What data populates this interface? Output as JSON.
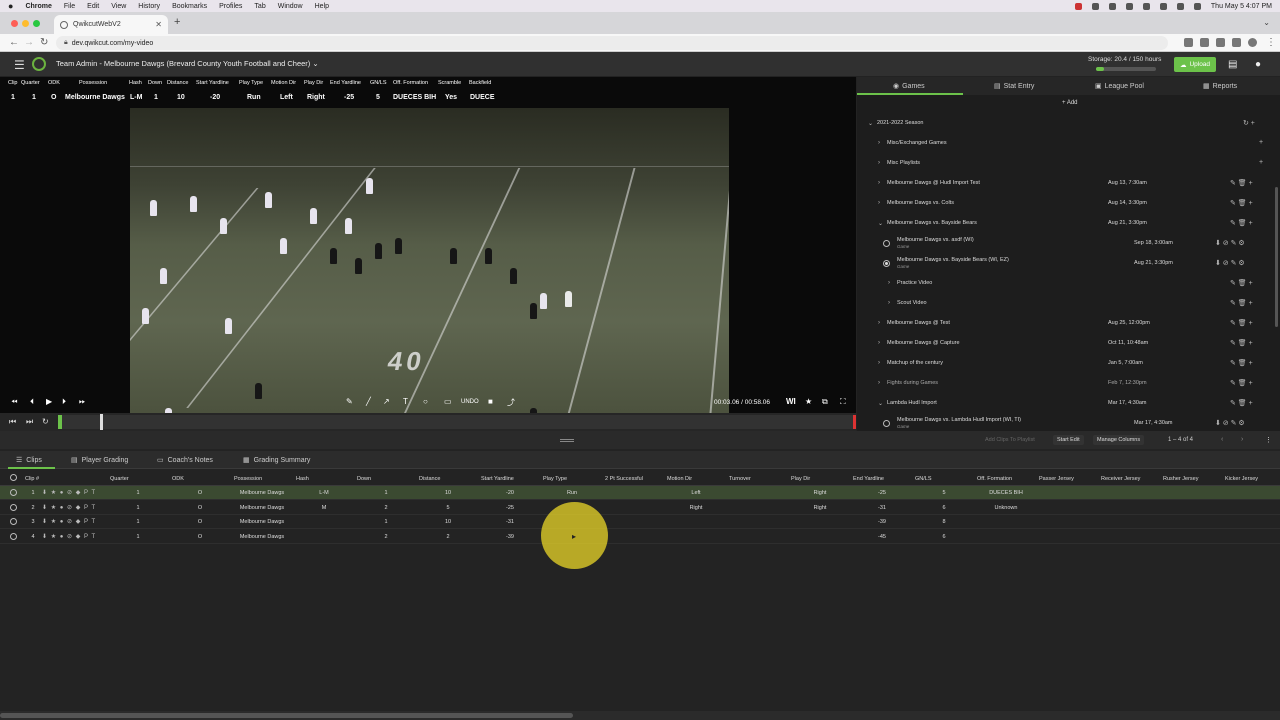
{
  "mac": {
    "menu": [
      "Chrome",
      "File",
      "Edit",
      "View",
      "History",
      "Bookmarks",
      "Profiles",
      "Tab",
      "Window",
      "Help"
    ],
    "clock": "Thu May 5  4:07 PM"
  },
  "browser": {
    "tab_title": "QwikcutWebV2",
    "url": "dev.qwikcut.com/my-video"
  },
  "header": {
    "title": "Team Admin - Melbourne Dawgs (Brevard County Youth Football and Cheer)",
    "storage": "Storage: 20.4 / 150 hours",
    "storage_fraction": 0.136,
    "upload_label": "Upload"
  },
  "clip_stats": {
    "columns": [
      "Clip",
      "Quarter",
      "ODK",
      "Possession",
      "Hash",
      "Down",
      "Distance",
      "Start Yardline",
      "Play Type",
      "Motion Dir",
      "Play Dir",
      "End Yardline",
      "GN/LS",
      "Off. Formation",
      "Scramble",
      "Backfield"
    ],
    "values": [
      "1",
      "1",
      "O",
      "Melbourne Dawgs",
      "L-M",
      "1",
      "10",
      "-20",
      "Run",
      "Left",
      "Right",
      "-25",
      "5",
      "DUECES BIH",
      "Yes",
      "DUECE"
    ]
  },
  "video": {
    "yard_marker": "40",
    "undo_label": "UNDO",
    "time": "00:03.06 / 00:58.06",
    "wi_label": "WI"
  },
  "side_tabs": [
    {
      "label": "Games",
      "icon": "play-circle-icon"
    },
    {
      "label": "Stat Entry",
      "icon": "stat-entry-icon"
    },
    {
      "label": "League Pool",
      "icon": "league-pool-icon"
    },
    {
      "label": "Reports",
      "icon": "reports-icon"
    }
  ],
  "add_label": "Add",
  "tree": [
    {
      "label": "2021-2022 Season",
      "date": "",
      "level": 0,
      "expanded": true
    },
    {
      "label": "Misc/Exchanged Games",
      "date": "",
      "level": 1,
      "expanded": false
    },
    {
      "label": "Misc Playlists",
      "date": "",
      "level": 1,
      "expanded": false
    },
    {
      "label": "Melbourne Dawgs @ Hudl Import Test",
      "date": "Aug 13, 7:30am",
      "level": 1,
      "expanded": false
    },
    {
      "label": "Melbourne Dawgs vs. Colts",
      "date": "Aug 14, 3:30pm",
      "level": 1,
      "expanded": false
    },
    {
      "label": "Melbourne Dawgs vs. Bayside Bears",
      "date": "Aug 21, 3:30pm",
      "level": 1,
      "expanded": true
    },
    {
      "label": "Melbourne Dawgs vs. asdf (WI)",
      "sub": "Game",
      "date": "Sep 18, 3:00am",
      "level": 2,
      "radio": true,
      "checked": false
    },
    {
      "label": "Melbourne Dawgs vs. Bayside Bears (WI, EZ)",
      "sub": "Game",
      "date": "Aug 21, 3:30pm",
      "level": 2,
      "radio": true,
      "checked": true
    },
    {
      "label": "Practice Video",
      "date": "",
      "level": 2,
      "expanded": false
    },
    {
      "label": "Scout Video",
      "date": "",
      "level": 2,
      "expanded": false
    },
    {
      "label": "Melbourne Dawgs @ Test",
      "date": "Aug 25, 12:00pm",
      "level": 1,
      "expanded": false
    },
    {
      "label": "Melbourne Dawgs @ Capture",
      "date": "Oct 11, 10:48am",
      "level": 1,
      "expanded": false
    },
    {
      "label": "Matchup of the century",
      "date": "Jan 5, 7:00am",
      "level": 1,
      "expanded": false
    },
    {
      "label": "Fights during Games",
      "date": "Feb 7, 12:30pm",
      "level": 1,
      "expanded": false,
      "dim": true
    },
    {
      "label": "Lambda Hudl Import",
      "date": "Mar 17, 4:30am",
      "level": 1,
      "expanded": true
    },
    {
      "label": "Melbourne Dawgs vs. Lambda Hudl Import (WI, TI)",
      "sub": "Game",
      "date": "Mar 17, 4:30am",
      "level": 2,
      "radio": true,
      "checked": false
    }
  ],
  "panel_tools": {
    "add_clips": "Add Clips To Playlist",
    "start_edit": "Start Edit",
    "manage_columns": "Manage Columns",
    "count": "1 – 4 of 4"
  },
  "bottom_tabs": [
    {
      "label": "Clips",
      "icon": "list-icon"
    },
    {
      "label": "Player Grading",
      "icon": "grading-icon"
    },
    {
      "label": "Coach's Notes",
      "icon": "notes-icon"
    },
    {
      "label": "Grading Summary",
      "icon": "summary-icon"
    }
  ],
  "table": {
    "headers": [
      "Clip #",
      "Quarter",
      "ODK",
      "Possession",
      "Hash",
      "Down",
      "Distance",
      "Start Yardline",
      "Play Type",
      "2 Pt Successful",
      "Motion Dir",
      "Turnover",
      "Play Dir",
      "End Yardline",
      "GN/LS",
      "Off. Formation",
      "Passer Jersey",
      "Receiver Jersey",
      "Rusher Jersey",
      "Kicker Jersey"
    ],
    "rows": [
      [
        "1",
        "1",
        "O",
        "Melbourne Dawgs",
        "L-M",
        "1",
        "10",
        "-20",
        "Run",
        "",
        "Left",
        "",
        "Right",
        "-25",
        "5",
        "DUECES BIH",
        "",
        "",
        "",
        ""
      ],
      [
        "2",
        "1",
        "O",
        "Melbourne Dawgs",
        "M",
        "2",
        "5",
        "-25",
        "",
        "",
        "Right",
        "",
        "Right",
        "-31",
        "6",
        "Unknown",
        "",
        "",
        "",
        ""
      ],
      [
        "3",
        "1",
        "O",
        "Melbourne Dawgs",
        "",
        "1",
        "10",
        "-31",
        "",
        "",
        "",
        "",
        "",
        "-39",
        "8",
        "",
        "",
        "",
        "",
        ""
      ],
      [
        "4",
        "1",
        "O",
        "Melbourne Dawgs",
        "",
        "2",
        "2",
        "-39",
        "",
        "",
        "",
        "",
        "",
        "-45",
        "6",
        "",
        "",
        "",
        "",
        ""
      ]
    ],
    "row_icons": "⬇ ★ ● ⊘ ◆ P T"
  }
}
